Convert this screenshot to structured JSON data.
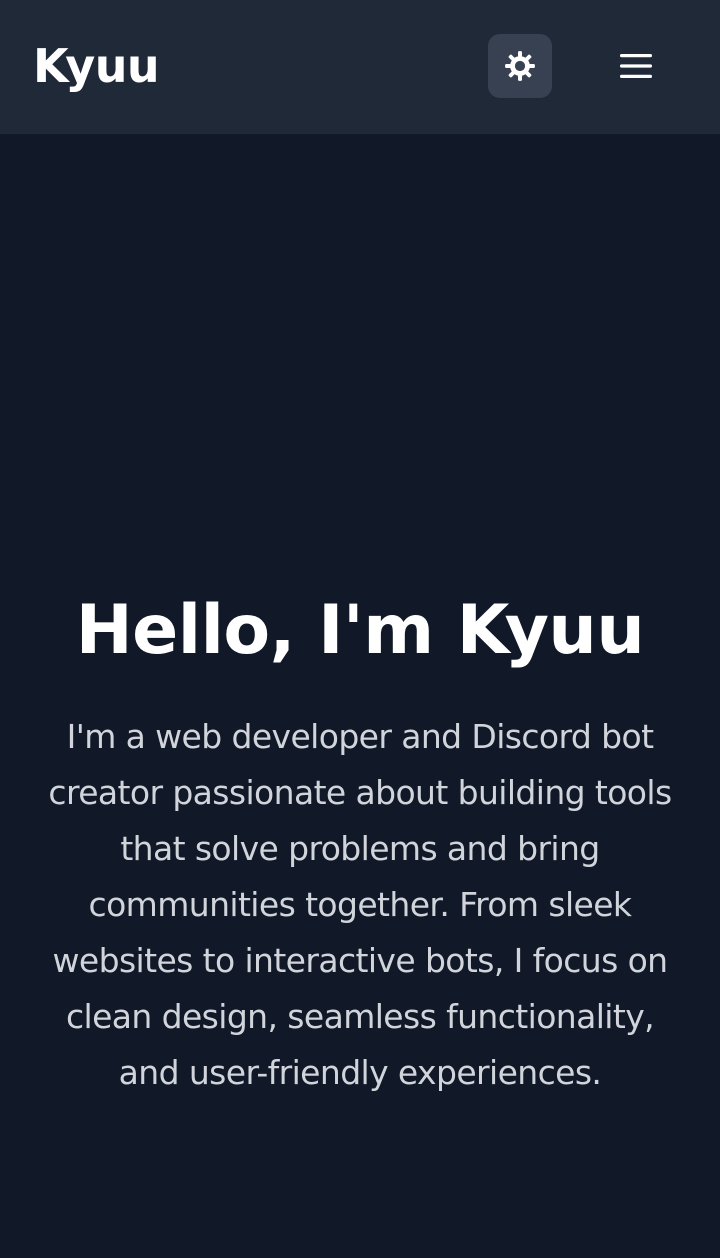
{
  "header": {
    "brand": "Kyuu",
    "theme_toggle_icon": "sun-icon",
    "menu_icon": "hamburger-menu-icon"
  },
  "hero": {
    "title": "Hello, I'm Kyuu",
    "description": "I'm a web developer and Discord bot creator passionate about building tools that solve problems and bring communities together. From sleek websites to interactive bots, I focus on clean design, seamless functionality, and user-friendly experiences."
  },
  "colors": {
    "background": "#111827",
    "header_background": "#1f2937",
    "toggle_background": "#374151",
    "heading_text": "#ffffff",
    "body_text": "#d1d5db"
  }
}
